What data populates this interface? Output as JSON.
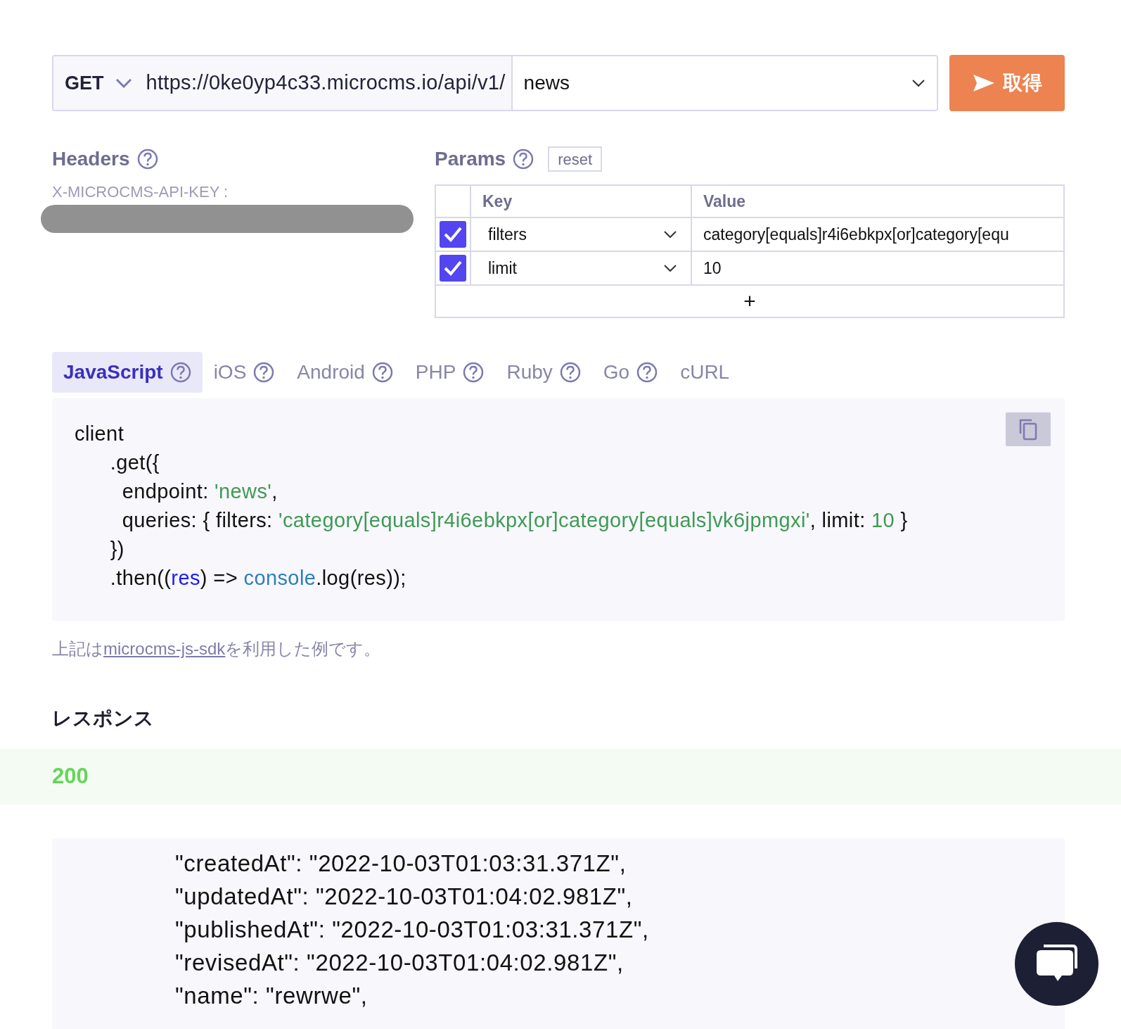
{
  "request": {
    "method": "GET",
    "base_url": "https://0ke0yp4c33.microcms.io/api/v1/",
    "endpoint": "news",
    "send_label": "取得"
  },
  "headers": {
    "title": "Headers",
    "key_label": "X-MICROCMS-API-KEY :"
  },
  "params": {
    "title": "Params",
    "reset_label": "reset",
    "columns": [
      "Key",
      "Value"
    ],
    "rows": [
      {
        "enabled": true,
        "key": "filters",
        "value": "category[equals]r4i6ebkpx[or]category[equ"
      },
      {
        "enabled": true,
        "key": "limit",
        "value": "10"
      }
    ],
    "add_label": "+"
  },
  "code_tabs": [
    {
      "label": "JavaScript",
      "selected": true,
      "help": true
    },
    {
      "label": "iOS",
      "selected": false,
      "help": true
    },
    {
      "label": "Android",
      "selected": false,
      "help": true
    },
    {
      "label": "PHP",
      "selected": false,
      "help": true
    },
    {
      "label": "Ruby",
      "selected": false,
      "help": true
    },
    {
      "label": "Go",
      "selected": false,
      "help": true
    },
    {
      "label": "cURL",
      "selected": false,
      "help": false
    }
  ],
  "code_lines": [
    [
      {
        "kind": "plain",
        "text": "client"
      }
    ],
    [
      {
        "kind": "plain",
        "text": "      .get({"
      }
    ],
    [
      {
        "kind": "plain",
        "text": "        endpoint: "
      },
      {
        "kind": "string",
        "text": "'news'"
      },
      {
        "kind": "plain",
        "text": ","
      }
    ],
    [
      {
        "kind": "plain",
        "text": "        queries: { filters: "
      },
      {
        "kind": "string",
        "text": "'category[equals]r4i6ebkpx[or]category[equals]vk6jpmgxi'"
      },
      {
        "kind": "plain",
        "text": ", limit: "
      },
      {
        "kind": "number",
        "text": "10"
      },
      {
        "kind": "plain",
        "text": " }"
      }
    ],
    [
      {
        "kind": "plain",
        "text": "      })"
      }
    ],
    [
      {
        "kind": "plain",
        "text": "      .then(("
      },
      {
        "kind": "param",
        "text": "res"
      },
      {
        "kind": "plain",
        "text": ") => "
      },
      {
        "kind": "builtin",
        "text": "console"
      },
      {
        "kind": "plain",
        "text": ".log(res));"
      }
    ]
  ],
  "note": {
    "before": "上記は",
    "link": "microcms-js-sdk",
    "after": "を利用した例です。"
  },
  "response": {
    "title": "レスポンス",
    "status": "200",
    "body_lines": [
      "\"createdAt\": \"2022-10-03T01:03:31.371Z\",",
      "\"updatedAt\": \"2022-10-03T01:04:02.981Z\",",
      "\"publishedAt\": \"2022-10-03T01:03:31.371Z\",",
      "\"revisedAt\": \"2022-10-03T01:04:02.981Z\",",
      "\"name\": \"rewrwe\","
    ]
  }
}
